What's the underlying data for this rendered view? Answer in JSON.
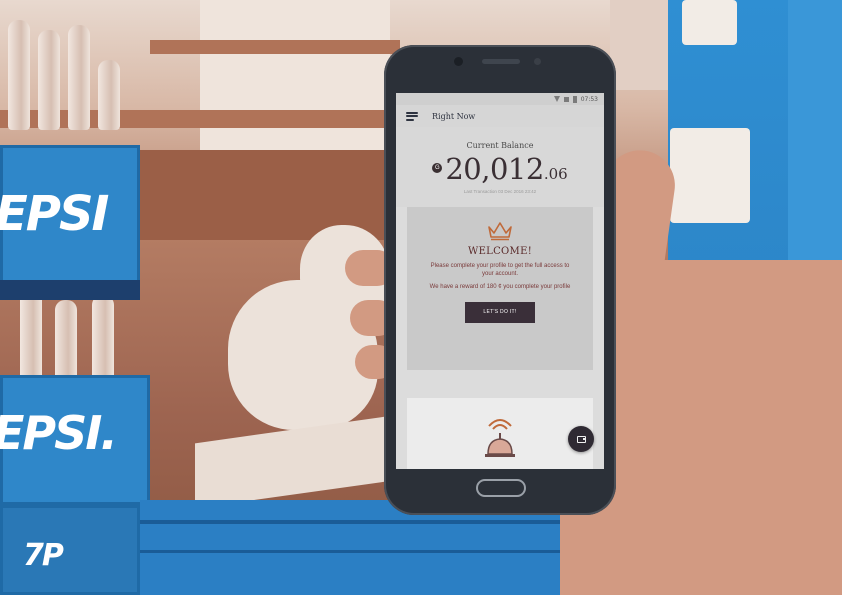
{
  "status_bar": {
    "time": "07:53"
  },
  "app_bar": {
    "title": "Right Now",
    "menu_icon": "menu-icon"
  },
  "balance": {
    "label": "Current Balance",
    "currency_symbol": "G",
    "amount_main": "20,012",
    "amount_cents": ".06",
    "last_transaction": "Last Transaction 03 Dec 2016 23:42"
  },
  "welcome_card": {
    "icon": "crown-icon",
    "title": "WELCOME!",
    "message": "Please complete your profile to get the full access to your account.",
    "reward": "We have a reward of 180 ¢ you complete your profile",
    "button_label": "LET'S DO IT!"
  },
  "lower_card": {
    "icon": "bell-icon"
  },
  "fab": {
    "icon": "wallet-icon"
  },
  "background": {
    "crate_label_top": "EPSI",
    "crate_label_bottom": "EPSI.",
    "bottom_logo": "7P"
  },
  "colors": {
    "accent_dark": "#3a2f39",
    "crown": "#c06a3a",
    "welcome_title": "#5a2a2a",
    "crate_blue": "#2f87c9"
  }
}
